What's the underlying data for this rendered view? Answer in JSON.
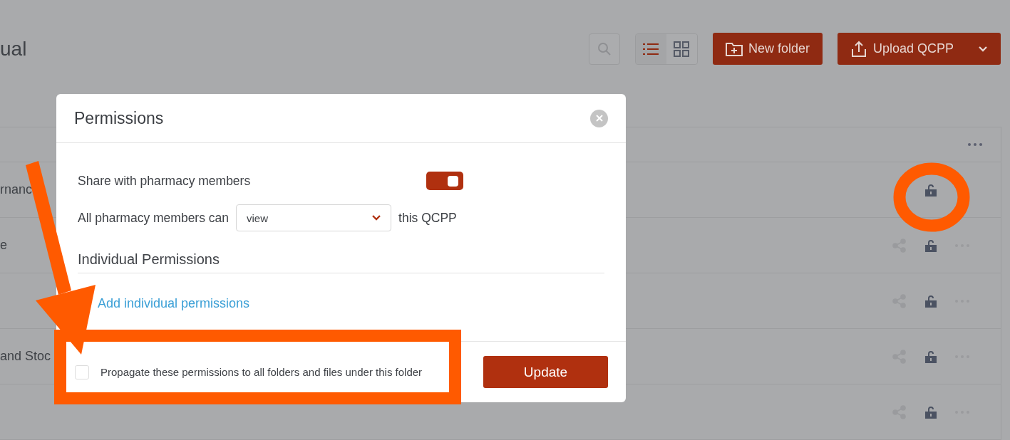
{
  "page": {
    "title": "ual",
    "view_toggle": [
      {
        "kind": "list",
        "selected": true
      },
      {
        "kind": "grid",
        "selected": false
      }
    ],
    "buttons": [
      {
        "kind": "folder",
        "label": "New folder"
      },
      {
        "kind": "upload",
        "label": "Upload QCPP"
      }
    ]
  },
  "table": {
    "rows": [
      {
        "name": "rnanc",
        "icons": [
          {
            "kind": "lock"
          }
        ]
      },
      {
        "name": "e",
        "icons": [
          {
            "kind": "share"
          },
          {
            "kind": "lock"
          },
          {
            "kind": "more"
          }
        ]
      },
      {
        "icons": [
          {
            "kind": "share"
          },
          {
            "kind": "lock"
          },
          {
            "kind": "more"
          }
        ]
      },
      {
        "name": "and Stoc",
        "icons": [
          {
            "kind": "share"
          },
          {
            "kind": "lock"
          },
          {
            "kind": "more"
          }
        ]
      },
      {
        "icons": [
          {
            "kind": "share"
          },
          {
            "kind": "lock"
          },
          {
            "kind": "more"
          }
        ]
      }
    ]
  },
  "modal": {
    "title": "Permissions",
    "share_label": "Share with pharmacy members",
    "share_on": true,
    "access_prefix": "All pharmacy members can",
    "access_value": "view",
    "access_suffix": "this QCPP",
    "section": "Individual Permissions",
    "add_link": "Add individual permissions",
    "propagate_label": "Propagate these permissions to all folders and files under this folder",
    "propagate_checked": false,
    "submit": "Update"
  },
  "annotations": [
    {
      "kind": "arrow",
      "color": "#ff5a00"
    },
    {
      "kind": "box",
      "color": "#ff5a00"
    },
    {
      "kind": "circle",
      "color": "#ff5a00"
    }
  ]
}
